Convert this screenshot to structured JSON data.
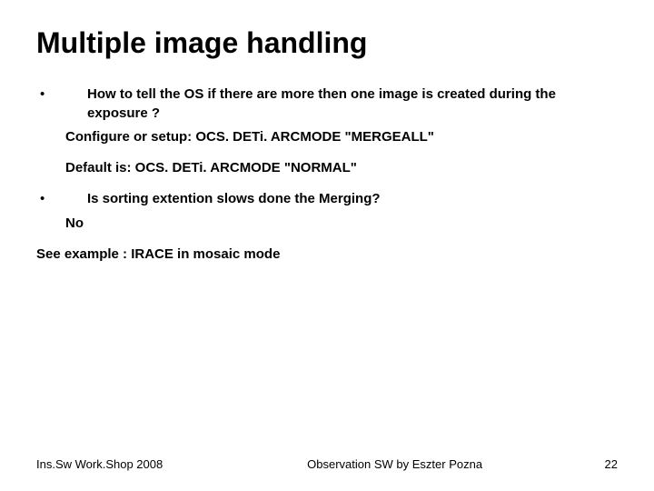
{
  "title": "Multiple image handling",
  "bullets": [
    {
      "question": "How to tell the OS if there are more then one image is created during the exposure ?",
      "answers": [
        "Configure or setup: OCS. DETi. ARCMODE \"MERGEALL\"",
        "Default is: OCS. DETi. ARCMODE \"NORMAL\""
      ]
    },
    {
      "question": "Is sorting extention slows done the Merging?",
      "answers": [
        "No"
      ]
    }
  ],
  "see_also": "See example : IRACE in mosaic mode",
  "footer": {
    "left": "Ins.Sw Work.Shop 2008",
    "center": "Observation SW by Eszter Pozna",
    "right": "22"
  }
}
